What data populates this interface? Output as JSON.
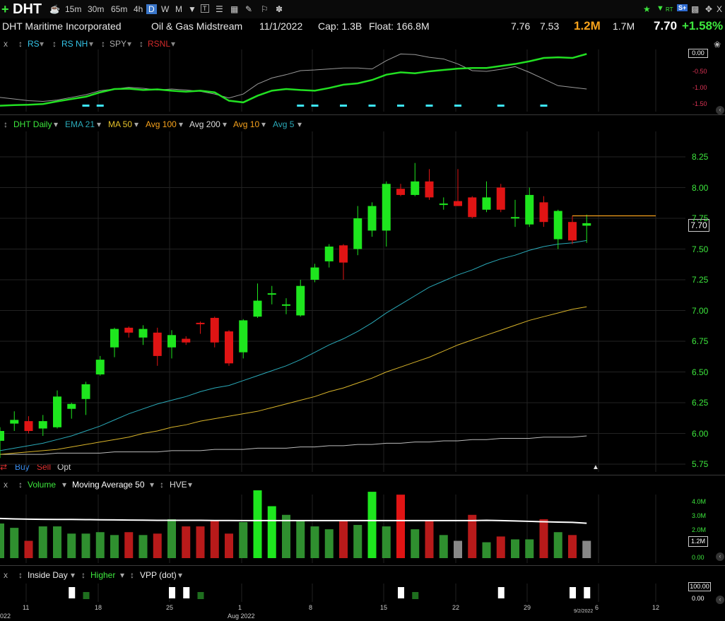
{
  "toolbar": {
    "ticker": "DHT",
    "timeframes": [
      "15m",
      "30m",
      "65m",
      "4h",
      "D",
      "W",
      "M"
    ],
    "selected_timeframe": "D",
    "right_labels": {
      "rt": "RT",
      "s": "S+"
    }
  },
  "info": {
    "company": "DHT Maritime Incorporated",
    "industry": "Oil & Gas Midstream",
    "date": "11/1/2022",
    "cap": "Cap: 1.3B",
    "float": "Float: 166.8M",
    "high": "7.76",
    "low": "7.53",
    "volume": "1.2M",
    "avg_volume": "1.7M",
    "last": "7.70",
    "change": "+1.58%"
  },
  "rs_pane": {
    "close": "x",
    "items": [
      "RS",
      "RS NH",
      "SPY",
      "RSNL"
    ],
    "ticks": [
      "0.00",
      "-0.50",
      "-1.00",
      "-1.50"
    ]
  },
  "price_pane": {
    "items": [
      "DHT Daily",
      "EMA 21",
      "MA 50",
      "Avg 100",
      "Avg 200",
      "Avg 10",
      "Avg 5"
    ],
    "ticks": [
      "8.25",
      "8.00",
      "7.75",
      "7.50",
      "7.25",
      "7.00",
      "6.75",
      "6.50",
      "6.25",
      "6.00",
      "5.75"
    ],
    "last_label": "7.70",
    "trade_buttons": [
      "Buy",
      "Sell",
      "Opt"
    ]
  },
  "volume_pane": {
    "close": "x",
    "items": [
      "Volume",
      "Moving Average 50",
      "HVE"
    ],
    "ticks": [
      "4.0M",
      "3.0M",
      "2.0M",
      "0.00"
    ],
    "last_label": "1.2M"
  },
  "signal_pane": {
    "close": "x",
    "items": [
      "Inside Day",
      "Higher",
      "VPP (dot)"
    ],
    "tags": [
      "100.00",
      "0.00"
    ]
  },
  "x_axis": {
    "dates": [
      "11",
      "18",
      "25",
      "1",
      "8",
      "15",
      "22",
      "29",
      "6",
      "12"
    ],
    "month_label": "Aug 2022",
    "year_left": "022",
    "cursor_date": "9/2/2022"
  },
  "colors": {
    "up": "#1ee61e",
    "down": "#e01414",
    "ema": "#2aa9b8",
    "ma50": "#d8b42a",
    "ma200": "#bbbbbb",
    "accent_orange": "#f7a21c",
    "accent_green": "#3de73d"
  },
  "chart_data": {
    "type": "candlestick",
    "note_series": "daily OHLC read from price pane",
    "candles": [
      {
        "o": 5.94,
        "h": 6.05,
        "l": 5.8,
        "c": 6.02
      },
      {
        "o": 6.08,
        "h": 6.18,
        "l": 6.02,
        "c": 6.11
      },
      {
        "o": 6.1,
        "h": 6.14,
        "l": 6.0,
        "c": 6.02
      },
      {
        "o": 6.04,
        "h": 6.15,
        "l": 5.98,
        "c": 6.1
      },
      {
        "o": 6.05,
        "h": 6.35,
        "l": 6.04,
        "c": 6.3
      },
      {
        "o": 6.2,
        "h": 6.25,
        "l": 6.12,
        "c": 6.24
      },
      {
        "o": 6.28,
        "h": 6.42,
        "l": 6.15,
        "c": 6.4
      },
      {
        "o": 6.48,
        "h": 6.63,
        "l": 6.47,
        "c": 6.6
      },
      {
        "o": 6.7,
        "h": 6.86,
        "l": 6.62,
        "c": 6.85
      },
      {
        "o": 6.86,
        "h": 6.87,
        "l": 6.78,
        "c": 6.82
      },
      {
        "o": 6.78,
        "h": 6.88,
        "l": 6.72,
        "c": 6.85
      },
      {
        "o": 6.82,
        "h": 6.86,
        "l": 6.55,
        "c": 6.63
      },
      {
        "o": 6.7,
        "h": 6.84,
        "l": 6.61,
        "c": 6.8
      },
      {
        "o": 6.77,
        "h": 6.79,
        "l": 6.72,
        "c": 6.74
      },
      {
        "o": 6.9,
        "h": 6.91,
        "l": 6.81,
        "c": 6.89
      },
      {
        "o": 6.94,
        "h": 6.95,
        "l": 6.7,
        "c": 6.74
      },
      {
        "o": 6.83,
        "h": 6.84,
        "l": 6.55,
        "c": 6.57
      },
      {
        "o": 6.66,
        "h": 6.93,
        "l": 6.61,
        "c": 6.92
      },
      {
        "o": 6.95,
        "h": 7.22,
        "l": 6.94,
        "c": 7.08
      },
      {
        "o": 7.14,
        "h": 7.2,
        "l": 7.05,
        "c": 7.14
      },
      {
        "o": 7.05,
        "h": 7.1,
        "l": 6.97,
        "c": 7.05
      },
      {
        "o": 6.96,
        "h": 7.25,
        "l": 6.95,
        "c": 7.2
      },
      {
        "o": 7.25,
        "h": 7.38,
        "l": 7.23,
        "c": 7.35
      },
      {
        "o": 7.4,
        "h": 7.54,
        "l": 7.35,
        "c": 7.52
      },
      {
        "o": 7.53,
        "h": 7.54,
        "l": 7.25,
        "c": 7.39
      },
      {
        "o": 7.5,
        "h": 7.85,
        "l": 7.45,
        "c": 7.75
      },
      {
        "o": 7.65,
        "h": 7.88,
        "l": 7.6,
        "c": 7.85
      },
      {
        "o": 7.65,
        "h": 8.05,
        "l": 7.52,
        "c": 8.03
      },
      {
        "o": 7.99,
        "h": 8.03,
        "l": 7.93,
        "c": 7.94
      },
      {
        "o": 7.94,
        "h": 8.2,
        "l": 7.93,
        "c": 8.05
      },
      {
        "o": 8.05,
        "h": 8.15,
        "l": 7.9,
        "c": 7.92
      },
      {
        "o": 7.86,
        "h": 7.92,
        "l": 7.82,
        "c": 7.87
      },
      {
        "o": 7.89,
        "h": 8.15,
        "l": 7.85,
        "c": 7.85
      },
      {
        "o": 7.92,
        "h": 7.93,
        "l": 7.75,
        "c": 7.76
      },
      {
        "o": 7.82,
        "h": 8.05,
        "l": 7.8,
        "c": 7.92
      },
      {
        "o": 8.0,
        "h": 8.03,
        "l": 7.8,
        "c": 7.82
      },
      {
        "o": 7.76,
        "h": 7.9,
        "l": 7.68,
        "c": 7.76
      },
      {
        "o": 7.7,
        "h": 8.0,
        "l": 7.68,
        "c": 7.94
      },
      {
        "o": 7.88,
        "h": 7.93,
        "l": 7.68,
        "c": 7.72
      },
      {
        "o": 7.58,
        "h": 7.82,
        "l": 7.5,
        "c": 7.81
      },
      {
        "o": 7.72,
        "h": 7.77,
        "l": 7.54,
        "c": 7.57
      },
      {
        "o": 7.69,
        "h": 7.78,
        "l": 7.55,
        "c": 7.71
      }
    ],
    "ema21": [
      5.86,
      5.88,
      5.9,
      5.92,
      5.95,
      5.98,
      6.02,
      6.06,
      6.11,
      6.16,
      6.2,
      6.24,
      6.27,
      6.3,
      6.34,
      6.37,
      6.39,
      6.43,
      6.47,
      6.51,
      6.55,
      6.6,
      6.66,
      6.72,
      6.77,
      6.83,
      6.9,
      6.98,
      7.05,
      7.12,
      7.19,
      7.24,
      7.29,
      7.33,
      7.38,
      7.42,
      7.45,
      7.49,
      7.52,
      7.54,
      7.55,
      7.57
    ],
    "ma50": [
      5.83,
      5.84,
      5.85,
      5.86,
      5.87,
      5.89,
      5.91,
      5.93,
      5.95,
      5.97,
      6.0,
      6.02,
      6.05,
      6.07,
      6.1,
      6.12,
      6.14,
      6.16,
      6.18,
      6.21,
      6.24,
      6.27,
      6.3,
      6.34,
      6.37,
      6.41,
      6.45,
      6.5,
      6.54,
      6.58,
      6.62,
      6.67,
      6.72,
      6.76,
      6.8,
      6.84,
      6.88,
      6.92,
      6.95,
      6.98,
      7.01,
      7.03
    ],
    "ma200": [
      5.83,
      5.83,
      5.83,
      5.83,
      5.84,
      5.84,
      5.84,
      5.84,
      5.85,
      5.85,
      5.85,
      5.85,
      5.86,
      5.86,
      5.86,
      5.87,
      5.87,
      5.87,
      5.88,
      5.88,
      5.88,
      5.89,
      5.89,
      5.9,
      5.9,
      5.91,
      5.91,
      5.92,
      5.92,
      5.93,
      5.93,
      5.94,
      5.94,
      5.95,
      5.95,
      5.96,
      5.96,
      5.96,
      5.97,
      5.97,
      5.97,
      5.98
    ],
    "volume": [
      2.4,
      2.1,
      1.2,
      2.2,
      2.2,
      1.7,
      1.7,
      1.8,
      1.6,
      1.8,
      1.6,
      1.7,
      2.7,
      2.2,
      2.2,
      2.6,
      1.7,
      2.5,
      4.7,
      3.6,
      3.0,
      2.6,
      2.2,
      2.0,
      2.6,
      2.3,
      4.6,
      2.2,
      4.4,
      2.0,
      2.6,
      1.6,
      1.2,
      3.0,
      1.1,
      1.5,
      1.3,
      1.3,
      2.7,
      1.8,
      1.6,
      1.2
    ],
    "volume_ma50": [
      2.75,
      2.72,
      2.7,
      2.69,
      2.68,
      2.68,
      2.67,
      2.66,
      2.65,
      2.64,
      2.63,
      2.62,
      2.62,
      2.62,
      2.62,
      2.61,
      2.61,
      2.6,
      2.6,
      2.6,
      2.6,
      2.6,
      2.6,
      2.6,
      2.6,
      2.6,
      2.6,
      2.6,
      2.6,
      2.6,
      2.6,
      2.6,
      2.6,
      2.6,
      2.62,
      2.6,
      2.58,
      2.55,
      2.52,
      2.5,
      2.48,
      2.42
    ],
    "rs_line": [
      -1.55,
      -1.53,
      -1.52,
      -1.5,
      -1.42,
      -1.35,
      -1.28,
      -1.15,
      -1.05,
      -1.04,
      -1.08,
      -1.06,
      -1.1,
      -1.13,
      -1.1,
      -1.15,
      -1.4,
      -1.45,
      -1.25,
      -1.1,
      -1.05,
      -1.08,
      -1.1,
      -1.02,
      -0.92,
      -0.88,
      -0.78,
      -0.62,
      -0.55,
      -0.58,
      -0.52,
      -0.48,
      -0.44,
      -0.42,
      -0.42,
      -0.36,
      -0.3,
      -0.22,
      -0.12,
      -0.1,
      -0.12,
      0.0
    ],
    "spy_line": [
      -1.3,
      -1.35,
      -1.4,
      -1.42,
      -1.38,
      -1.3,
      -1.22,
      -1.1,
      -1.05,
      -1.0,
      -1.03,
      -1.08,
      -1.05,
      -1.08,
      -1.12,
      -1.2,
      -1.32,
      -1.2,
      -0.9,
      -0.72,
      -0.62,
      -0.5,
      -0.48,
      -0.45,
      -0.42,
      -0.42,
      -0.45,
      -0.2,
      0.0,
      -0.02,
      -0.1,
      -0.15,
      -0.3,
      -0.5,
      -0.52,
      -0.46,
      -0.38,
      -0.55,
      -0.75,
      -0.95,
      -1.0,
      -1.05
    ],
    "rs_nh_marks": [
      6,
      7,
      21,
      22,
      24,
      26,
      28,
      30,
      32,
      35,
      38
    ]
  }
}
